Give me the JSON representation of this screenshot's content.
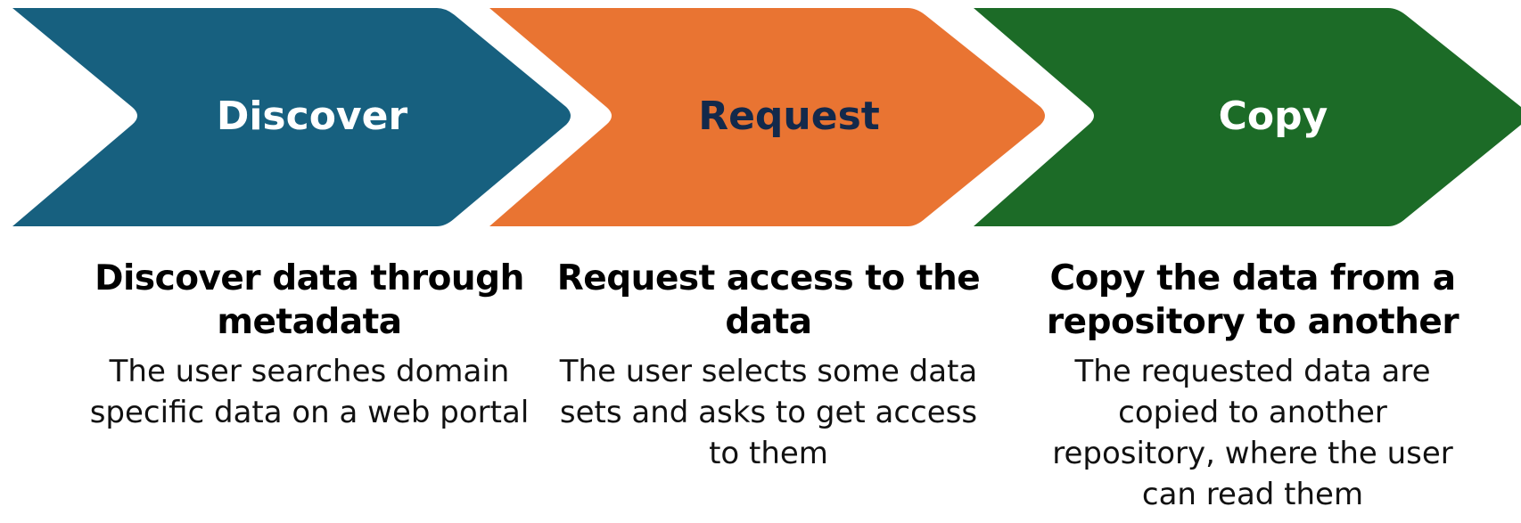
{
  "colors": {
    "discover": "#17607f",
    "request": "#e97432",
    "copy": "#1c6b27",
    "discover_label": "#ffffff",
    "request_label": "#13294b",
    "copy_label": "#ffffff"
  },
  "steps": [
    {
      "label": "Discover",
      "heading_line1": "Discover data through",
      "heading_line2": "metadata",
      "desc_line1": "The user searches domain",
      "desc_line2": "specific data on a web portal",
      "desc_line3": "",
      "desc_line4": ""
    },
    {
      "label": "Request",
      "heading_line1": "Request access to the",
      "heading_line2": "data",
      "desc_line1": "The user selects some data",
      "desc_line2": "sets and asks to get access",
      "desc_line3": "to them",
      "desc_line4": ""
    },
    {
      "label": "Copy",
      "heading_line1": "Copy the data from a",
      "heading_line2": "repository to another",
      "desc_line1": "The requested data are",
      "desc_line2": "copied to another",
      "desc_line3": "repository, where the user",
      "desc_line4": "can read them"
    }
  ]
}
